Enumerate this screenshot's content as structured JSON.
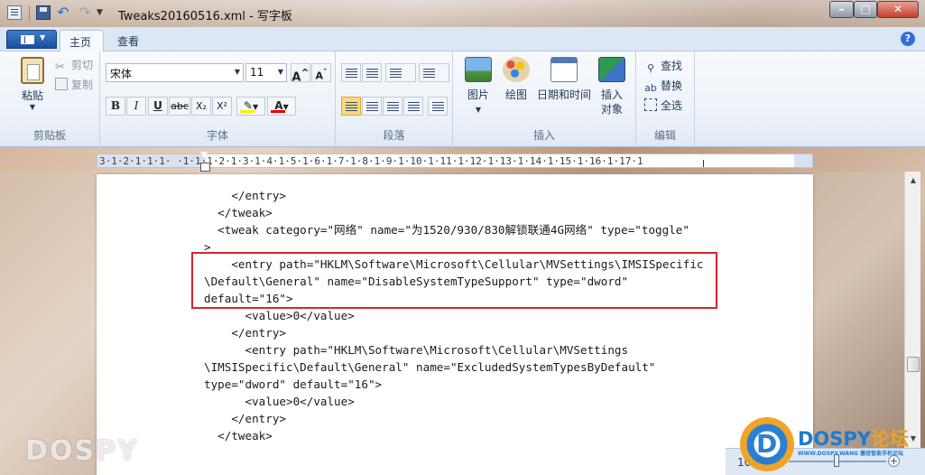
{
  "window": {
    "title": "Tweaks20160516.xml - 写字板"
  },
  "menu": {
    "tabs": [
      {
        "label": "主页"
      },
      {
        "label": "查看"
      }
    ]
  },
  "ribbon": {
    "clipboard": {
      "label": "剪贴板",
      "paste": "粘贴",
      "cut": "剪切",
      "copy": "复制"
    },
    "font": {
      "label": "字体",
      "name": "宋体",
      "size": "11",
      "grow": "A",
      "shrink": "A",
      "bold": "B",
      "italic": "I",
      "underline": "U",
      "strike": "abc",
      "subscript": "X₂",
      "superscript": "X²",
      "color": "A"
    },
    "paragraph": {
      "label": "段落"
    },
    "insert": {
      "label": "插入",
      "picture": "图片",
      "paint": "绘图",
      "datetime": "日期和时间",
      "object_line1": "插入",
      "object_line2": "对象"
    },
    "edit": {
      "label": "编辑",
      "find": "查找",
      "replace": "替换",
      "select_all": "全选"
    }
  },
  "ruler": {
    "text": "3·1·2·1·1·1·  ·1·1·1·2·1·3·1·4·1·5·1·6·1·7·1·8·1·9·1·10·1·11·1·12·1·13·1·14·1·15·1·16·1·17·1"
  },
  "document": {
    "lines": [
      "    </entry>",
      "  </tweak>",
      "  <tweak category=\"网络\" name=\"为1520/930/830解锁联通4G网络\" type=\"toggle\"",
      ">",
      "    <entry path=\"HKLM\\Software\\Microsoft\\Cellular\\MVSettings\\IMSISpecific",
      "\\Default\\General\" name=\"DisableSystemTypeSupport\" type=\"dword\"",
      "default=\"16\">",
      "      <value>0</value>",
      "    </entry>",
      "      <entry path=\"HKLM\\Software\\Microsoft\\Cellular\\MVSettings",
      "\\IMSISpecific\\Default\\General\" name=\"ExcludedSystemTypesByDefault\"",
      "type=\"dword\" default=\"16\">",
      "      <value>0</value>",
      "    </entry>",
      "  </tweak>"
    ]
  },
  "status": {
    "zoom": "100%"
  },
  "watermarks": {
    "left": "DOSPY",
    "brand": "DOSPY",
    "brand_cn": "论坛",
    "sub": "WWW.DOSPY.WANG 塞班智能手机论坛"
  },
  "colors": {
    "accent": "#1c4f9c",
    "highlight_box": "#d4272e"
  }
}
